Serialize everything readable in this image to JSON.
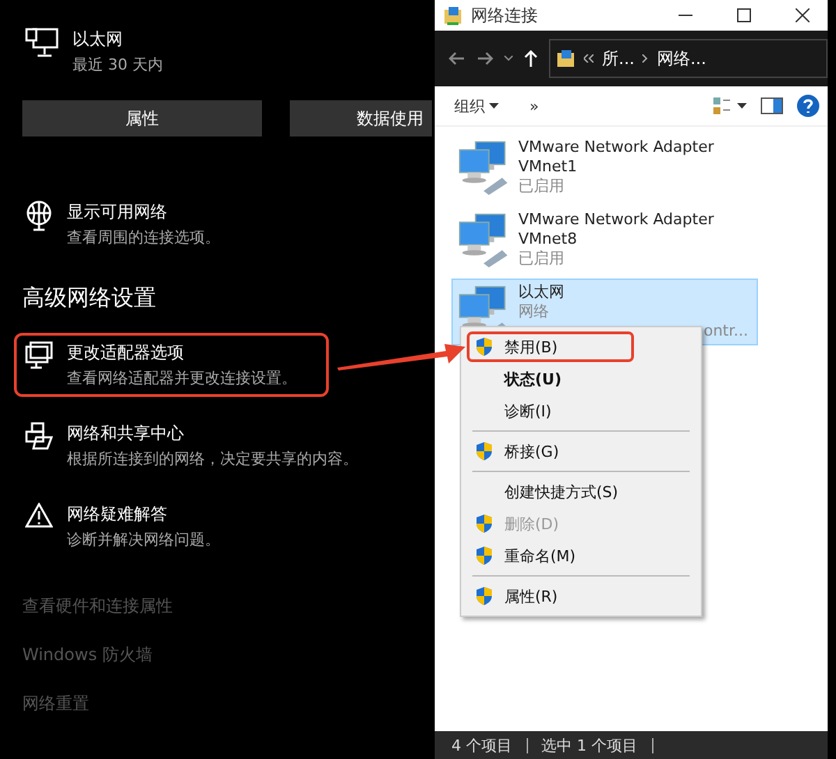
{
  "settings": {
    "connection": {
      "name": "以太网",
      "subtitle": "最近 30 天内"
    },
    "buttons": [
      "属性",
      "数据使用"
    ],
    "options": [
      {
        "kind": "globe",
        "title": "显示可用网络",
        "description": "查看周围的连接选项。",
        "highlighted": false
      }
    ],
    "heading": "高级网络设置",
    "advanced": [
      {
        "kind": "monitor",
        "title": "更改适配器选项",
        "description": "查看网络适配器并更改连接设置。",
        "highlighted": true
      },
      {
        "kind": "sharing",
        "title": "网络和共享中心",
        "description": "根据所连接到的网络，决定要共享的内容。",
        "highlighted": false
      },
      {
        "kind": "warning",
        "title": "网络疑难解答",
        "description": "诊断并解决网络问题。",
        "highlighted": false
      }
    ],
    "links": [
      "查看硬件和连接属性",
      "Windows 防火墙",
      "网络重置"
    ]
  },
  "explorer": {
    "title": "网络连接",
    "breadcrumbs": [
      "所...",
      "网络..."
    ],
    "toolbar": {
      "organize": "组织",
      "more": "»"
    },
    "items": [
      {
        "name": "VMware Network Adapter VMnet1",
        "status": "已启用",
        "selected": false
      },
      {
        "name": "VMware Network Adapter VMnet8",
        "status": "已启用",
        "selected": false
      },
      {
        "name": "以太网",
        "status": "网络",
        "detail": "ontr...",
        "selected": true
      }
    ],
    "context_menu": [
      {
        "kind": "item",
        "label": "禁用(B)",
        "shield": true,
        "bold": false,
        "disabled": false,
        "highlighted": true
      },
      {
        "kind": "item",
        "label": "状态(U)",
        "shield": false,
        "bold": true,
        "disabled": false,
        "highlighted": false
      },
      {
        "kind": "item",
        "label": "诊断(I)",
        "shield": false,
        "bold": false,
        "disabled": false,
        "highlighted": false
      },
      {
        "kind": "separator"
      },
      {
        "kind": "item",
        "label": "桥接(G)",
        "shield": true,
        "bold": false,
        "disabled": false,
        "highlighted": false
      },
      {
        "kind": "separator"
      },
      {
        "kind": "item",
        "label": "创建快捷方式(S)",
        "shield": false,
        "bold": false,
        "disabled": false,
        "highlighted": false
      },
      {
        "kind": "item",
        "label": "删除(D)",
        "shield": true,
        "bold": false,
        "disabled": true,
        "highlighted": false
      },
      {
        "kind": "item",
        "label": "重命名(M)",
        "shield": true,
        "bold": false,
        "disabled": false,
        "highlighted": false
      },
      {
        "kind": "separator"
      },
      {
        "kind": "item",
        "label": "属性(R)",
        "shield": true,
        "bold": false,
        "disabled": false,
        "highlighted": false
      }
    ],
    "status_bar": [
      "4 个项目",
      "选中 1 个项目"
    ]
  }
}
